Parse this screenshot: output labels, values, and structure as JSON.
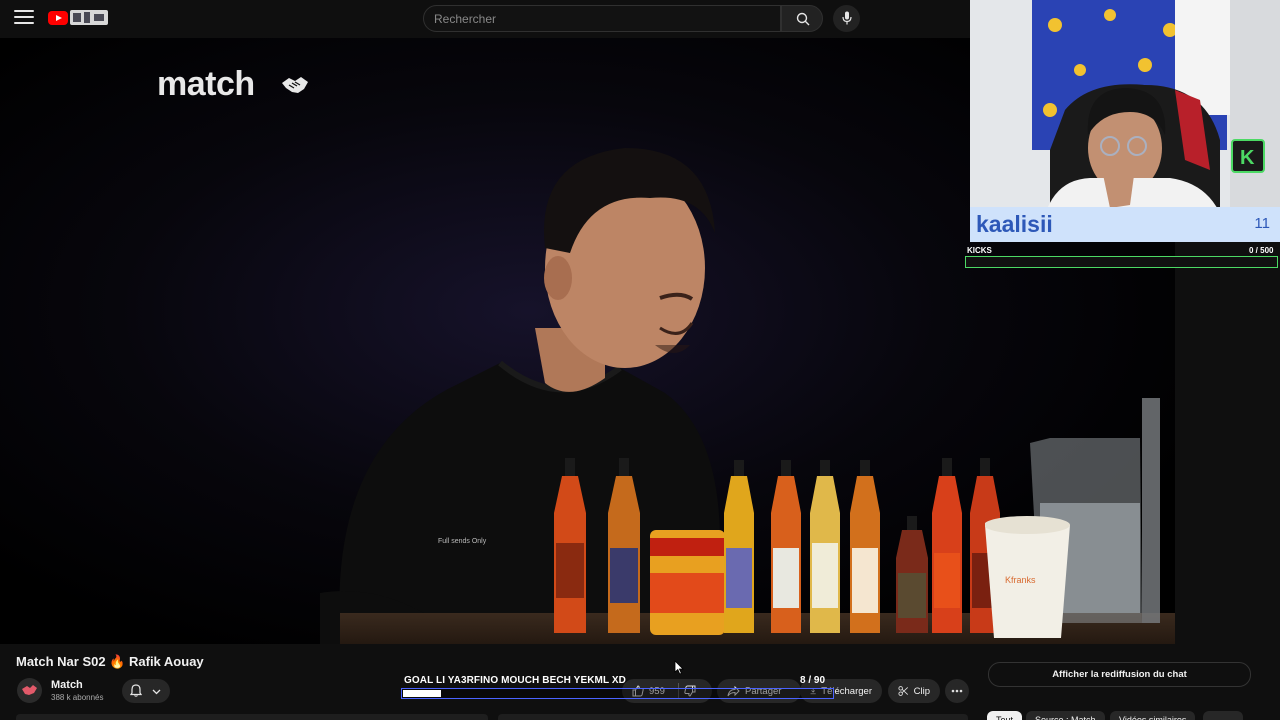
{
  "header": {
    "search_placeholder": "Rechercher"
  },
  "video": {
    "brand_logo_text": "match"
  },
  "webcam_overlay": {
    "streamer_name": "kaalisii",
    "counter": "11",
    "kicks_label": "KICKS",
    "kicks_progress_text": "0  / 500",
    "kicks_progress": 0
  },
  "goal_overlay": {
    "text": "GOAL LI YA3RFINO MOUCH BECH YEKML XD",
    "count_text": "8  / 90",
    "current": 8,
    "target": 90
  },
  "info": {
    "title": "Match Nar S02 🔥 Rafik Aouay",
    "channel_name": "Match",
    "subscribers": "388 k abonnés"
  },
  "actions": {
    "likes": "959",
    "share_label": "Partager",
    "download_label": "Télécharger",
    "clip_label": "Clip"
  },
  "sidebar": {
    "chat_replay_label": "Afficher la rediffusion du chat",
    "chips": [
      "Tout",
      "Source : Match",
      "Vidéos similaires"
    ]
  }
}
